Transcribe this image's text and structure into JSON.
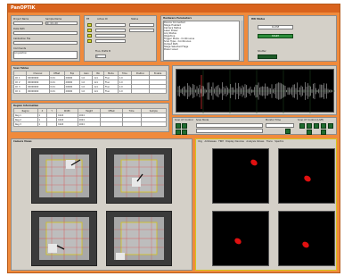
{
  "app": {
    "title": "PanOPTIK"
  },
  "top_left": {
    "labels": [
      "Project Name",
      "Sample Name",
      "Data Path",
      "Calibration File",
      "Comments"
    ],
    "values": [
      "",
      "ID: 0/1.00",
      "",
      "",
      "Acquisition"
    ]
  },
  "top_mid": {
    "header_a": "EE",
    "header_b": "Active ID",
    "header_c": "Status",
    "label_bottom": "Fluo. Prefix B",
    "value_bottom": "0"
  },
  "status_table": {
    "header": "Hardware Parameters",
    "rows": [
      "Device Connected",
      "Stage Enabled",
      "Camera Status",
      "Laser Power",
      "Acq Status",
      "Objective",
      "Trigger Mode - Continuous",
      "Scan Type - Continuous",
      "Output Path",
      "Stage Selected Flags",
      "Power Level"
    ]
  },
  "right_panel": {
    "header": "HW Status",
    "btn1": "CLOSE",
    "btn2": "START",
    "label_low": "Shutter"
  },
  "channel_table": {
    "title": "Scan Tables",
    "columns": [
      "",
      "Channel",
      "Offset",
      "Exp",
      "Gain",
      "Bin",
      "Mode",
      "Time",
      "Position",
      "Enable"
    ],
    "rows": [
      [
        "Ch 1",
        "00000000",
        "0.01",
        "20000",
        "1.0",
        "1x1",
        "Fluo",
        "1.0",
        "",
        ""
      ],
      [
        "Ch 2",
        "00000000",
        "0.01",
        "20000",
        "1.0",
        "1x1",
        "Fluo",
        "1.0",
        "",
        ""
      ],
      [
        "Ch 3",
        "00000000",
        "0.01",
        "20000",
        "1.0",
        "1x1",
        "Fluo",
        "1.0",
        "",
        ""
      ],
      [
        "Ch 4",
        "00000000",
        "0.01",
        "20000",
        "1.0",
        "1x1",
        "Fluo",
        "1.0",
        "",
        ""
      ]
    ]
  },
  "region_table": {
    "title": "Region Information",
    "columns": [
      "Region",
      "X",
      "Y",
      "Width",
      "Height",
      "Offset",
      "Time",
      "Sample"
    ],
    "rows": [
      [
        "Reg 1",
        "1",
        "",
        "1024",
        "1024",
        "",
        "",
        ""
      ],
      [
        "Reg 2",
        "1",
        "",
        "1024",
        "1024",
        "",
        "",
        ""
      ],
      [
        "Reg 3",
        "1",
        "",
        "1024",
        "1024",
        "",
        "",
        ""
      ]
    ]
  },
  "controls_row": {
    "label1": "Scan XY Control",
    "label2": "Scan Mode",
    "label3": "Monitor Time",
    "label4": "Scan XY Control (LIVE)"
  },
  "left_view": {
    "title": "Camera Views"
  },
  "right_view": {
    "tabs": [
      "Img",
      "Addresses",
      "FRM",
      "Display Devices",
      "Analysis Values",
      "Trace",
      "Spectra"
    ]
  },
  "colors": {
    "orange": "#f08a3c",
    "panel": "#d4d0c8",
    "green": "#2c8c3a",
    "spot": "#e01010"
  }
}
